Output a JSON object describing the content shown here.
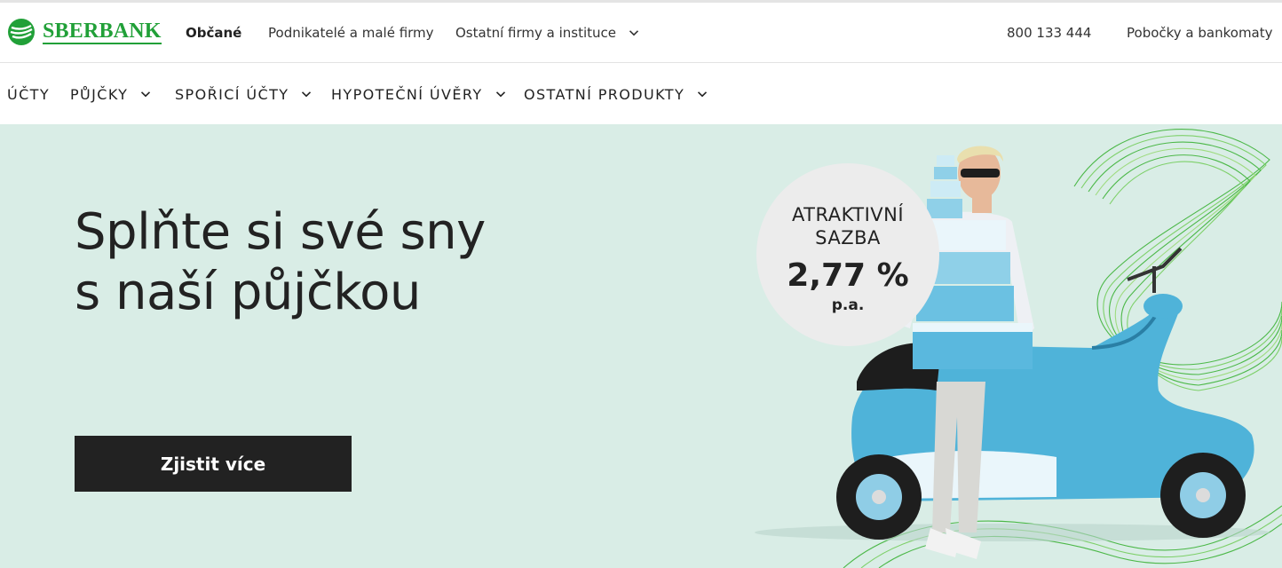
{
  "brand": {
    "name": "SBERBANK",
    "color": "#21a038"
  },
  "topbar": {
    "segments": [
      {
        "label": "Občané",
        "active": true
      },
      {
        "label": "Podnikatelé a malé firmy",
        "active": false
      },
      {
        "label": "Ostatní firmy a instituce",
        "active": false,
        "icon": "chevron-down-icon"
      }
    ],
    "phone": "800 133 444",
    "branches": "Pobočky a bankomaty"
  },
  "product_nav": {
    "items": [
      {
        "label": "ÚČTY"
      },
      {
        "label": "PŮJČKY",
        "icon": "chevron-down-icon"
      },
      {
        "label": "SPOŘICÍ ÚČTY",
        "icon": "chevron-down-icon"
      },
      {
        "label": "HYPOTEČNÍ ÚVĚRY",
        "icon": "chevron-down-icon"
      },
      {
        "label": "OSTATNÍ PRODUKTY",
        "icon": "chevron-down-icon"
      }
    ]
  },
  "hero": {
    "title_line1": "Splňte si své sny",
    "title_line2": "s naší půjčkou",
    "cta_label": "Zjistit více",
    "background": "#d9ede6",
    "badge": {
      "line1": "ATRAKTIVNÍ",
      "line2": "SAZBA",
      "rate": "2,77 %",
      "period": "p.a."
    }
  }
}
